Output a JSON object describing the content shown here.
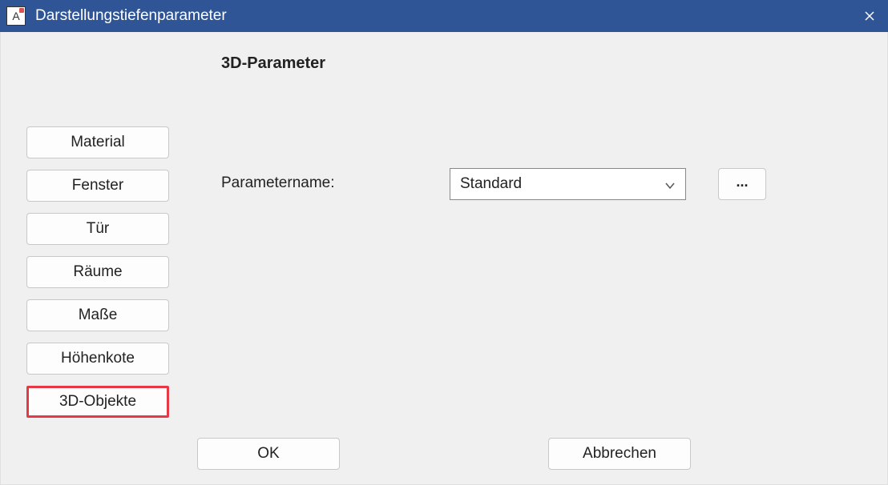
{
  "window": {
    "title": "Darstellungstiefenparameter",
    "icon_letter": "A"
  },
  "heading": "3D-Parameter",
  "sidebar": {
    "items": [
      {
        "label": "Material"
      },
      {
        "label": "Fenster"
      },
      {
        "label": "Tür"
      },
      {
        "label": "Räume"
      },
      {
        "label": "Maße"
      },
      {
        "label": "Höhenkote"
      },
      {
        "label": "3D-Objekte"
      }
    ]
  },
  "param": {
    "label": "Parametername:",
    "selected": "Standard",
    "browse_label": "..."
  },
  "buttons": {
    "ok": "OK",
    "cancel": "Abbrechen"
  }
}
